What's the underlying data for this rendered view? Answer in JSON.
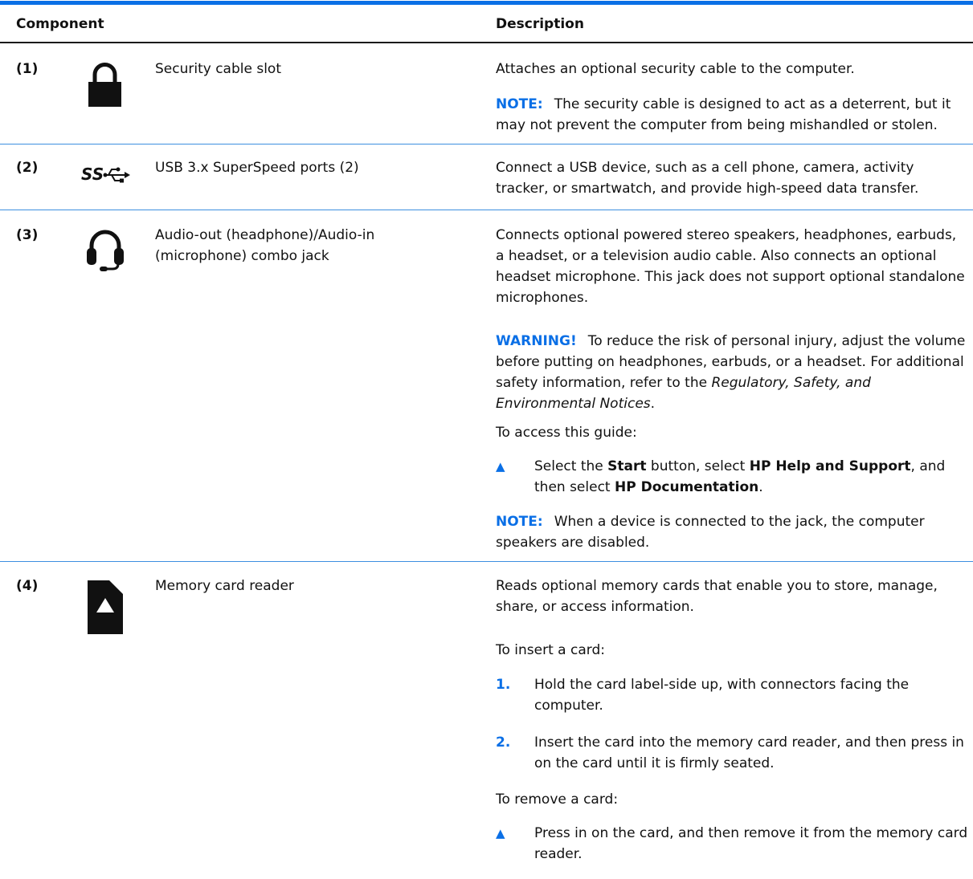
{
  "header": {
    "component": "Component",
    "description": "Description"
  },
  "rows": [
    {
      "number": "(1)",
      "icon": "lock-icon",
      "component": "Security cable slot",
      "desc": "Attaches an optional security cable to the computer.",
      "note_label": "NOTE:",
      "note_text": "The security cable is designed to act as a deterrent, but it may not prevent the computer from being mishandled or stolen."
    },
    {
      "number": "(2)",
      "icon": "usb-superspeed-icon",
      "icon_text": "SS",
      "component": "USB 3.x SuperSpeed ports (2)",
      "desc": "Connect a USB device, such as a cell phone, camera, activity tracker, or smartwatch, and provide high-speed data transfer."
    },
    {
      "number": "(3)",
      "icon": "headset-icon",
      "component": "Audio-out (headphone)/Audio-in (microphone) combo jack",
      "desc": "Connects optional powered stereo speakers, headphones, earbuds, a headset, or a television audio cable. Also connects an optional headset microphone. This jack does not support optional standalone microphones.",
      "warning_label": "WARNING!",
      "warning_text": "To reduce the risk of personal injury, adjust the volume before putting on headphones, earbuds, or a headset. For additional safety information, refer to the ",
      "warning_doc": "Regulatory, Safety, and Environmental Notices",
      "warning_end": ".",
      "access_intro": "To access this guide:",
      "step_a": "Select the ",
      "step_b": "Start",
      "step_c": " button, select ",
      "step_d": "HP Help and Support",
      "step_e": ", and then select ",
      "step_f": "HP Documentation",
      "step_g": ".",
      "note_label": "NOTE:",
      "note_text": "When a device is connected to the jack, the computer speakers are disabled."
    },
    {
      "number": "(4)",
      "icon": "memory-card-icon",
      "component": "Memory card reader",
      "desc": "Reads optional memory cards that enable you to store, manage, share, or access information.",
      "insert_intro": "To insert a card:",
      "step1_num": "1.",
      "step1": "Hold the card label-side up, with connectors facing the computer.",
      "step2_num": "2.",
      "step2": "Insert the card into the memory card reader, and then press in on the card until it is firmly seated.",
      "remove_intro": "To remove a card:",
      "remove_step": "Press in on the card, and then remove it from the memory card reader."
    }
  ],
  "colors": {
    "accent": "#0a6fe6",
    "rule": "#3d8fe0"
  }
}
